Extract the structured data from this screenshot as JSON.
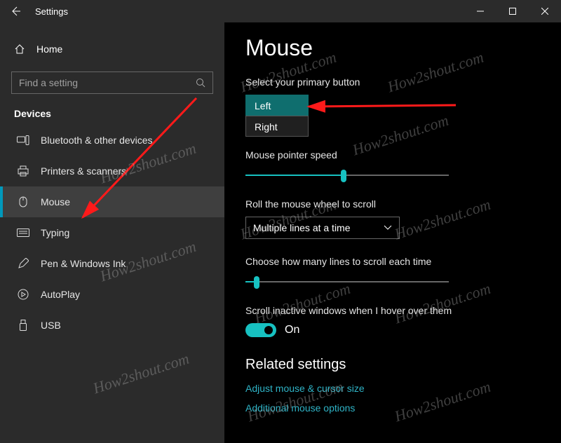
{
  "titlebar": {
    "title": "Settings"
  },
  "sidebar": {
    "home": "Home",
    "search_placeholder": "Find a setting",
    "category": "Devices",
    "items": [
      {
        "label": "Bluetooth & other devices"
      },
      {
        "label": "Printers & scanners"
      },
      {
        "label": "Mouse"
      },
      {
        "label": "Typing"
      },
      {
        "label": "Pen & Windows Ink"
      },
      {
        "label": "AutoPlay"
      },
      {
        "label": "USB"
      }
    ]
  },
  "main": {
    "heading": "Mouse",
    "primary_label": "Select your primary button",
    "primary_options": {
      "left": "Left",
      "right": "Right"
    },
    "speed_label": "Mouse pointer speed",
    "wheel_label": "Roll the mouse wheel to scroll",
    "wheel_value": "Multiple lines at a time",
    "lines_label": "Choose how many lines to scroll each time",
    "inactive_label": "Scroll inactive windows when I hover over them",
    "toggle_state": "On",
    "related": "Related settings",
    "link1": "Adjust mouse & cursor size",
    "link2": "Additional mouse options"
  },
  "watermark": "How2shout.com"
}
